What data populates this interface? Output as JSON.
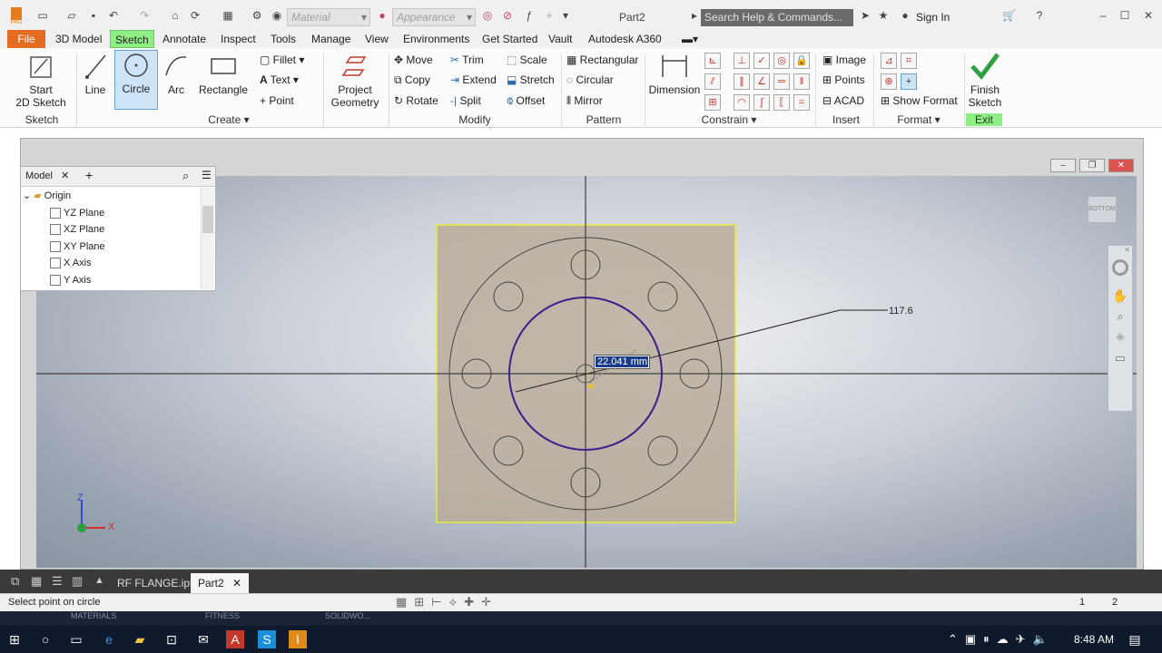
{
  "titlebar": {
    "doc_title": "Part2",
    "material_placeholder": "Material",
    "appearance_placeholder": "Appearance",
    "search_placeholder": "Search Help & Commands...",
    "sign_in": "Sign In",
    "app_badge": "PRO"
  },
  "menu": {
    "items": [
      "File",
      "3D Model",
      "Sketch",
      "Annotate",
      "Inspect",
      "Tools",
      "Manage",
      "View",
      "Environments",
      "Get Started",
      "Vault",
      "Autodesk A360"
    ],
    "active": "Sketch"
  },
  "ribbon": {
    "sketch": {
      "start_line1": "Start",
      "start_line2": "2D Sketch",
      "label": "Sketch"
    },
    "create": {
      "line": "Line",
      "circle": "Circle",
      "arc": "Arc",
      "rectangle": "Rectangle",
      "fillet": "Fillet",
      "text": "Text",
      "point": "Point",
      "label": "Create"
    },
    "project": {
      "line1": "Project",
      "line2": "Geometry"
    },
    "modify": {
      "move": "Move",
      "trim": "Trim",
      "scale": "Scale",
      "copy": "Copy",
      "extend": "Extend",
      "stretch": "Stretch",
      "rotate": "Rotate",
      "split": "Split",
      "offset": "Offset",
      "label": "Modify"
    },
    "pattern": {
      "rectangular": "Rectangular",
      "circular": "Circular",
      "mirror": "Mirror",
      "label": "Pattern"
    },
    "constrain": {
      "dimension": "Dimension",
      "label": "Constrain"
    },
    "insert": {
      "image": "Image",
      "points": "Points",
      "acad": "ACAD",
      "label": "Insert"
    },
    "format": {
      "show_format": "Show Format",
      "label": "Format"
    },
    "exit": {
      "finish_line1": "Finish",
      "finish_line2": "Sketch",
      "label": "Exit"
    }
  },
  "browser": {
    "tab": "Model",
    "items": [
      {
        "label": "Origin",
        "type": "folder"
      },
      {
        "label": "YZ Plane",
        "type": "plane"
      },
      {
        "label": "XZ Plane",
        "type": "plane"
      },
      {
        "label": "XY Plane",
        "type": "plane"
      },
      {
        "label": "X Axis",
        "type": "axis"
      },
      {
        "label": "Y Axis",
        "type": "axis"
      }
    ]
  },
  "canvas": {
    "dimension_value": "117.6",
    "input_value": "22.041 mm",
    "viewcube_label": "BOTTOM",
    "triad_z": "Z",
    "triad_x": "X"
  },
  "tabs": {
    "items": [
      "RF FLANGE.ipt",
      "Part2"
    ],
    "active": "Part2"
  },
  "status": {
    "prompt": "Select point on circle",
    "num1": "1",
    "num2": "2"
  },
  "taskbar": {
    "underlay_left": "MATERIALS",
    "underlay_mid": "FITNESS",
    "underlay_right": "SOLIDWO...",
    "time": "8:48 AM"
  },
  "colors": {
    "file_tab": "#e46b22",
    "sketch_tab": "#8ef084",
    "sketch_circle": "#3b1f8c",
    "selection_box": "#e8e830",
    "flange_fill": "#b9ad9c"
  }
}
